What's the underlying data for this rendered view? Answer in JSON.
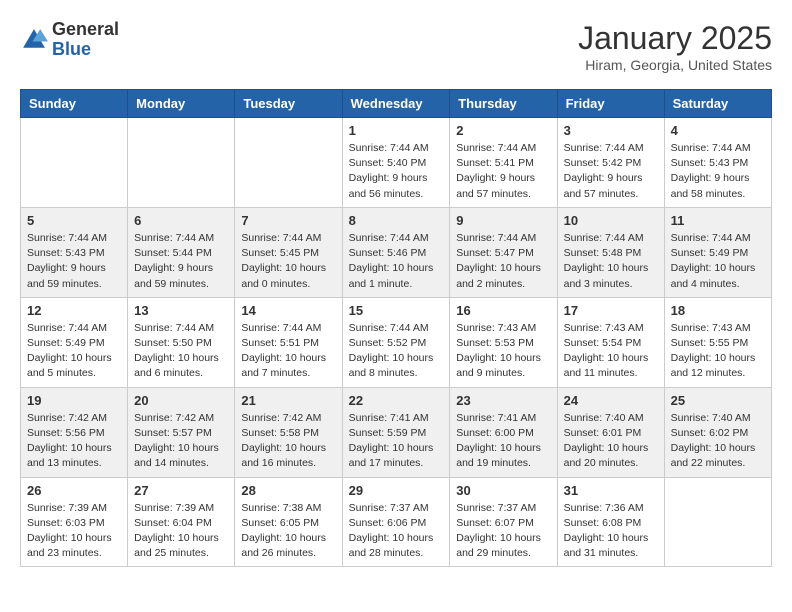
{
  "header": {
    "logo_line1": "General",
    "logo_line2": "Blue",
    "month_title": "January 2025",
    "location": "Hiram, Georgia, United States"
  },
  "days_of_week": [
    "Sunday",
    "Monday",
    "Tuesday",
    "Wednesday",
    "Thursday",
    "Friday",
    "Saturday"
  ],
  "weeks": [
    [
      {
        "day": "",
        "info": ""
      },
      {
        "day": "",
        "info": ""
      },
      {
        "day": "",
        "info": ""
      },
      {
        "day": "1",
        "info": "Sunrise: 7:44 AM\nSunset: 5:40 PM\nDaylight: 9 hours\nand 56 minutes."
      },
      {
        "day": "2",
        "info": "Sunrise: 7:44 AM\nSunset: 5:41 PM\nDaylight: 9 hours\nand 57 minutes."
      },
      {
        "day": "3",
        "info": "Sunrise: 7:44 AM\nSunset: 5:42 PM\nDaylight: 9 hours\nand 57 minutes."
      },
      {
        "day": "4",
        "info": "Sunrise: 7:44 AM\nSunset: 5:43 PM\nDaylight: 9 hours\nand 58 minutes."
      }
    ],
    [
      {
        "day": "5",
        "info": "Sunrise: 7:44 AM\nSunset: 5:43 PM\nDaylight: 9 hours\nand 59 minutes."
      },
      {
        "day": "6",
        "info": "Sunrise: 7:44 AM\nSunset: 5:44 PM\nDaylight: 9 hours\nand 59 minutes."
      },
      {
        "day": "7",
        "info": "Sunrise: 7:44 AM\nSunset: 5:45 PM\nDaylight: 10 hours\nand 0 minutes."
      },
      {
        "day": "8",
        "info": "Sunrise: 7:44 AM\nSunset: 5:46 PM\nDaylight: 10 hours\nand 1 minute."
      },
      {
        "day": "9",
        "info": "Sunrise: 7:44 AM\nSunset: 5:47 PM\nDaylight: 10 hours\nand 2 minutes."
      },
      {
        "day": "10",
        "info": "Sunrise: 7:44 AM\nSunset: 5:48 PM\nDaylight: 10 hours\nand 3 minutes."
      },
      {
        "day": "11",
        "info": "Sunrise: 7:44 AM\nSunset: 5:49 PM\nDaylight: 10 hours\nand 4 minutes."
      }
    ],
    [
      {
        "day": "12",
        "info": "Sunrise: 7:44 AM\nSunset: 5:49 PM\nDaylight: 10 hours\nand 5 minutes."
      },
      {
        "day": "13",
        "info": "Sunrise: 7:44 AM\nSunset: 5:50 PM\nDaylight: 10 hours\nand 6 minutes."
      },
      {
        "day": "14",
        "info": "Sunrise: 7:44 AM\nSunset: 5:51 PM\nDaylight: 10 hours\nand 7 minutes."
      },
      {
        "day": "15",
        "info": "Sunrise: 7:44 AM\nSunset: 5:52 PM\nDaylight: 10 hours\nand 8 minutes."
      },
      {
        "day": "16",
        "info": "Sunrise: 7:43 AM\nSunset: 5:53 PM\nDaylight: 10 hours\nand 9 minutes."
      },
      {
        "day": "17",
        "info": "Sunrise: 7:43 AM\nSunset: 5:54 PM\nDaylight: 10 hours\nand 11 minutes."
      },
      {
        "day": "18",
        "info": "Sunrise: 7:43 AM\nSunset: 5:55 PM\nDaylight: 10 hours\nand 12 minutes."
      }
    ],
    [
      {
        "day": "19",
        "info": "Sunrise: 7:42 AM\nSunset: 5:56 PM\nDaylight: 10 hours\nand 13 minutes."
      },
      {
        "day": "20",
        "info": "Sunrise: 7:42 AM\nSunset: 5:57 PM\nDaylight: 10 hours\nand 14 minutes."
      },
      {
        "day": "21",
        "info": "Sunrise: 7:42 AM\nSunset: 5:58 PM\nDaylight: 10 hours\nand 16 minutes."
      },
      {
        "day": "22",
        "info": "Sunrise: 7:41 AM\nSunset: 5:59 PM\nDaylight: 10 hours\nand 17 minutes."
      },
      {
        "day": "23",
        "info": "Sunrise: 7:41 AM\nSunset: 6:00 PM\nDaylight: 10 hours\nand 19 minutes."
      },
      {
        "day": "24",
        "info": "Sunrise: 7:40 AM\nSunset: 6:01 PM\nDaylight: 10 hours\nand 20 minutes."
      },
      {
        "day": "25",
        "info": "Sunrise: 7:40 AM\nSunset: 6:02 PM\nDaylight: 10 hours\nand 22 minutes."
      }
    ],
    [
      {
        "day": "26",
        "info": "Sunrise: 7:39 AM\nSunset: 6:03 PM\nDaylight: 10 hours\nand 23 minutes."
      },
      {
        "day": "27",
        "info": "Sunrise: 7:39 AM\nSunset: 6:04 PM\nDaylight: 10 hours\nand 25 minutes."
      },
      {
        "day": "28",
        "info": "Sunrise: 7:38 AM\nSunset: 6:05 PM\nDaylight: 10 hours\nand 26 minutes."
      },
      {
        "day": "29",
        "info": "Sunrise: 7:37 AM\nSunset: 6:06 PM\nDaylight: 10 hours\nand 28 minutes."
      },
      {
        "day": "30",
        "info": "Sunrise: 7:37 AM\nSunset: 6:07 PM\nDaylight: 10 hours\nand 29 minutes."
      },
      {
        "day": "31",
        "info": "Sunrise: 7:36 AM\nSunset: 6:08 PM\nDaylight: 10 hours\nand 31 minutes."
      },
      {
        "day": "",
        "info": ""
      }
    ]
  ]
}
